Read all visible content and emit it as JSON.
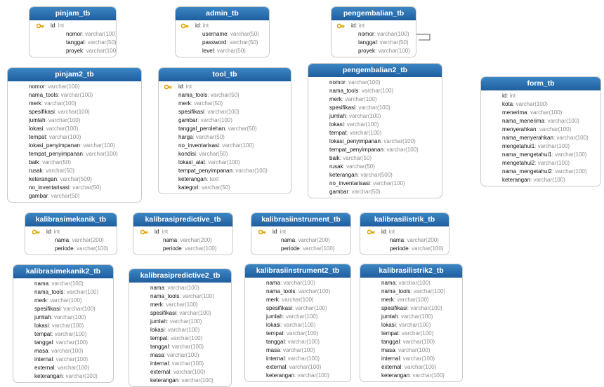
{
  "colors": {
    "header": "#2b6fb0",
    "header_text": "#ffffff",
    "type_text": "#8c8c8c",
    "field_text": "#111111",
    "key": "#e0a100"
  },
  "icons": {
    "primary_key": "key-icon"
  },
  "tables": [
    {
      "id": "pinjam_tb",
      "name": "pinjam_tb",
      "fields": [
        {
          "name": "id",
          "type": ": int",
          "pk": true
        },
        {
          "name": "nomor",
          "type": ": varchar(100)"
        },
        {
          "name": "tanggal",
          "type": ": varchar(50)"
        },
        {
          "name": "proyek",
          "type": ": varchar(100)"
        }
      ]
    },
    {
      "id": "admin_tb",
      "name": "admin_tb",
      "fields": [
        {
          "name": "id",
          "type": ": int",
          "pk": true
        },
        {
          "name": "username",
          "type": ": varchar(50)"
        },
        {
          "name": "password",
          "type": ": varchar(50)"
        },
        {
          "name": "level",
          "type": ": varchar(50)"
        }
      ]
    },
    {
      "id": "pengembalian_tb",
      "name": "pengembalian_tb",
      "fields": [
        {
          "name": "id",
          "type": ": int",
          "pk": true
        },
        {
          "name": "nomor",
          "type": ": varchar(100)"
        },
        {
          "name": "tanggal",
          "type": ": varchar(50)"
        },
        {
          "name": "proyek",
          "type": ": varchar(100)"
        }
      ]
    },
    {
      "id": "pinjam2_tb",
      "name": "pinjam2_tb",
      "fields": [
        {
          "name": "nomor",
          "type": ": varchar(100)"
        },
        {
          "name": "nama_tools",
          "type": ": varchar(100)"
        },
        {
          "name": "merk",
          "type": ": varchar(100)"
        },
        {
          "name": "spesifikasi",
          "type": ": varchar(100)"
        },
        {
          "name": "jumlah",
          "type": ": varchar(100)"
        },
        {
          "name": "lokasi",
          "type": ": varchar(100)"
        },
        {
          "name": "tempat",
          "type": ": varchar(100)"
        },
        {
          "name": "lokasi_penyimpanan",
          "type": ": varchar(100)"
        },
        {
          "name": "tempat_penyimpanan",
          "type": ": varchar(100)"
        },
        {
          "name": "baik",
          "type": ": varchar(50)"
        },
        {
          "name": "rusak",
          "type": ": varchar(50)"
        },
        {
          "name": "keterangan",
          "type": ": varchar(500)"
        },
        {
          "name": "no_inventarisasi",
          "type": ": varchar(50)"
        },
        {
          "name": "gambar",
          "type": ": varchar(50)"
        }
      ]
    },
    {
      "id": "tool_tb",
      "name": "tool_tb",
      "fields": [
        {
          "name": "id",
          "type": ": int",
          "pk": true
        },
        {
          "name": "nama_tools",
          "type": ": varchar(50)"
        },
        {
          "name": "merk",
          "type": ": varchar(50)"
        },
        {
          "name": "spesifikasi",
          "type": ": varchar(100)"
        },
        {
          "name": "gambar",
          "type": ": varchar(100)"
        },
        {
          "name": "tanggal_perolehan",
          "type": ": varchar(50)"
        },
        {
          "name": "harga",
          "type": ": varchar(50)"
        },
        {
          "name": "no_inventarisasi",
          "type": ": varchar(100)"
        },
        {
          "name": "kondisi",
          "type": ": varchar(50)"
        },
        {
          "name": "lokasi_alat",
          "type": ": varchar(100)"
        },
        {
          "name": "tempat_penyimpanan",
          "type": ": varchar(100)"
        },
        {
          "name": "keterangan",
          "type": ": text"
        },
        {
          "name": "kategori",
          "type": ": varchar(50)"
        }
      ]
    },
    {
      "id": "pengembalian2_tb",
      "name": "pengembalian2_tb",
      "fields": [
        {
          "name": "nomor",
          "type": ": varchar(100)"
        },
        {
          "name": "nama_tools",
          "type": ": varchar(100)"
        },
        {
          "name": "merk",
          "type": ": varchar(100)"
        },
        {
          "name": "spesifikasi",
          "type": ": varchar(100)"
        },
        {
          "name": "jumlah",
          "type": ": varchar(100)"
        },
        {
          "name": "lokasi",
          "type": ": varchar(100)"
        },
        {
          "name": "tempat",
          "type": ": varchar(100)"
        },
        {
          "name": "lokasi_penyimpanan",
          "type": ": varchar(100)"
        },
        {
          "name": "tempat_penyimpanan",
          "type": ": varchar(100)"
        },
        {
          "name": "baik",
          "type": ": varchar(50)"
        },
        {
          "name": "rusak",
          "type": ": varchar(50)"
        },
        {
          "name": "keterangan",
          "type": ": varchar(500)"
        },
        {
          "name": "no_inventarisasi",
          "type": ": varchar(100)"
        },
        {
          "name": "gambar",
          "type": ": varchar(50)"
        }
      ]
    },
    {
      "id": "form_tb",
      "name": "form_tb",
      "fields": [
        {
          "name": "id",
          "type": ": int"
        },
        {
          "name": "kota",
          "type": ": varchar(100)"
        },
        {
          "name": "menerima",
          "type": ": varchar(100)"
        },
        {
          "name": "nama_menerima",
          "type": ": varchar(100)"
        },
        {
          "name": "menyerahkan",
          "type": ": varchar(100)"
        },
        {
          "name": "nama_menyerahkan",
          "type": ": varchar(100)"
        },
        {
          "name": "mengetahui1",
          "type": ": varchar(100)"
        },
        {
          "name": "nama_mengetahui1",
          "type": ": varchar(100)"
        },
        {
          "name": "mengetahui2",
          "type": ": varchar(100)"
        },
        {
          "name": "nama_mengetahui2",
          "type": ": varchar(100)"
        },
        {
          "name": "keterangan",
          "type": ": varchar(100)"
        }
      ]
    },
    {
      "id": "kalibrasimekanik_tb",
      "name": "kalibrasimekanik_tb",
      "fields": [
        {
          "name": "id",
          "type": ": int",
          "pk": true
        },
        {
          "name": "nama",
          "type": ": varchar(200)"
        },
        {
          "name": "periode",
          "type": ": varchar(100)"
        }
      ]
    },
    {
      "id": "kalibrasipredictive_tb",
      "name": "kalibrasipredictive_tb",
      "fields": [
        {
          "name": "id",
          "type": ": int",
          "pk": true
        },
        {
          "name": "nama",
          "type": ": varchar(200)"
        },
        {
          "name": "periode",
          "type": ": varchar(100)"
        }
      ]
    },
    {
      "id": "kalibrasiinstrument_tb",
      "name": "kalibrasiinstrument_tb",
      "fields": [
        {
          "name": "id",
          "type": ": int",
          "pk": true
        },
        {
          "name": "nama",
          "type": ": varchar(200)"
        },
        {
          "name": "periode",
          "type": ": varchar(100)"
        }
      ]
    },
    {
      "id": "kalibrasilistrik_tb",
      "name": "kalibrasilistrik_tb",
      "fields": [
        {
          "name": "id",
          "type": ": int",
          "pk": true
        },
        {
          "name": "nama",
          "type": ": varchar(200)"
        },
        {
          "name": "periode",
          "type": ": varchar(100)"
        }
      ]
    },
    {
      "id": "kalibrasimekanik2_tb",
      "name": "kalibrasimekanik2_tb",
      "fields": [
        {
          "name": "nama",
          "type": ": varchar(100)"
        },
        {
          "name": "nama_tools",
          "type": ": varchar(100)"
        },
        {
          "name": "merk",
          "type": ": varchar(100)"
        },
        {
          "name": "spesifikasi",
          "type": ": varchar(100)"
        },
        {
          "name": "jumlah",
          "type": ": varchar(100)"
        },
        {
          "name": "lokasi",
          "type": ": varchar(100)"
        },
        {
          "name": "tempat",
          "type": ": varchar(100)"
        },
        {
          "name": "tanggal",
          "type": ": varchar(100)"
        },
        {
          "name": "masa",
          "type": ": varchar(100)"
        },
        {
          "name": "internal",
          "type": ": varchar(100)"
        },
        {
          "name": "external",
          "type": ": varchar(100)"
        },
        {
          "name": "keterangan",
          "type": ": varchar(100)"
        }
      ]
    },
    {
      "id": "kalibrasipredictive2_tb",
      "name": "kalibrasipredictive2_tb",
      "fields": [
        {
          "name": "nama",
          "type": ": varchar(100)"
        },
        {
          "name": "nama_tools",
          "type": ": varchar(100)"
        },
        {
          "name": "merk",
          "type": ": varchar(100)"
        },
        {
          "name": "spesifikasi",
          "type": ": varchar(100)"
        },
        {
          "name": "jumlah",
          "type": ": varchar(100)"
        },
        {
          "name": "lokasi",
          "type": ": varchar(100)"
        },
        {
          "name": "tempat",
          "type": ": varchar(100)"
        },
        {
          "name": "tanggal",
          "type": ": varchar(100)"
        },
        {
          "name": "masa",
          "type": ": varchar(100)"
        },
        {
          "name": "internal",
          "type": ": varchar(100)"
        },
        {
          "name": "external",
          "type": ": varchar(100)"
        },
        {
          "name": "keterangan",
          "type": ": varchar(100)"
        }
      ]
    },
    {
      "id": "kalibrasiinstrument2_tb",
      "name": "kalibrasiinstrument2_tb",
      "fields": [
        {
          "name": "nama",
          "type": ": varchar(100)"
        },
        {
          "name": "nama_tools",
          "type": ": varchar(100)"
        },
        {
          "name": "merk",
          "type": ": varchar(100)"
        },
        {
          "name": "spesifikasi",
          "type": ": varchar(100)"
        },
        {
          "name": "jumlah",
          "type": ": varchar(100)"
        },
        {
          "name": "lokasi",
          "type": ": varchar(100)"
        },
        {
          "name": "tempat",
          "type": ": varchar(100)"
        },
        {
          "name": "tanggal",
          "type": ": varchar(100)"
        },
        {
          "name": "masa",
          "type": ": varchar(100)"
        },
        {
          "name": "internal",
          "type": ": varchar(100)"
        },
        {
          "name": "external",
          "type": ": varchar(100)"
        },
        {
          "name": "keterangan",
          "type": ": varchar(100)"
        }
      ]
    },
    {
      "id": "kalibrasilistrik2_tb",
      "name": "kalibrasilistrik2_tb",
      "fields": [
        {
          "name": "nama",
          "type": ": varchar(100)"
        },
        {
          "name": "nama_tools",
          "type": ": varchar(100)"
        },
        {
          "name": "merk",
          "type": ": varchar(100)"
        },
        {
          "name": "spesifikasi",
          "type": ": varchar(100)"
        },
        {
          "name": "jumlah",
          "type": ": varchar(100)"
        },
        {
          "name": "lokasi",
          "type": ": varchar(100)"
        },
        {
          "name": "tempat",
          "type": ": varchar(100)"
        },
        {
          "name": "tanggal",
          "type": ": varchar(100)"
        },
        {
          "name": "masa",
          "type": ": varchar(100)"
        },
        {
          "name": "internal",
          "type": ": varchar(100)"
        },
        {
          "name": "external",
          "type": ": varchar(100)"
        },
        {
          "name": "keterangan",
          "type": ": varchar(100)"
        }
      ]
    }
  ]
}
